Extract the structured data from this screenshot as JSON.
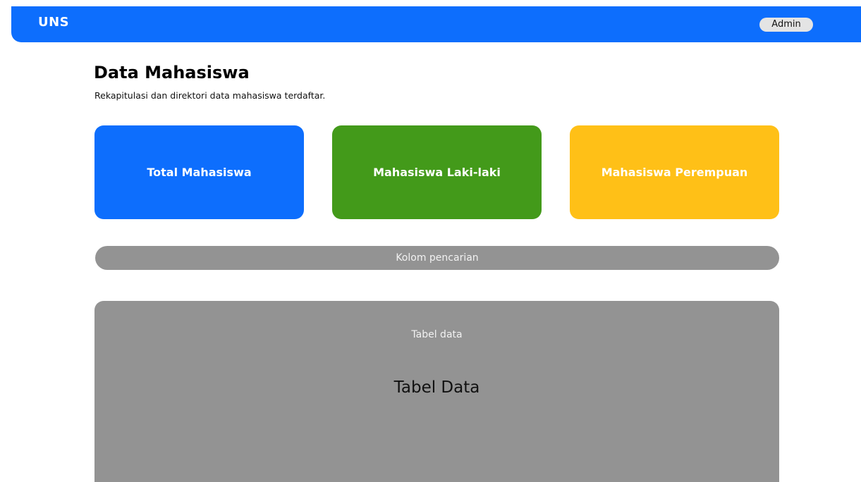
{
  "navbar": {
    "brand": "UNS",
    "user_label": "Admin",
    "color": "#0d6efd"
  },
  "header": {
    "title": "Data Mahasiswa",
    "subtitle": "Rekapitulasi dan direktori data mahasiswa terdaftar."
  },
  "cards": [
    {
      "label": "Total Mahasiswa",
      "color": "#0d6efd"
    },
    {
      "label": "Mahasiswa Laki-laki",
      "color": "#439a1a"
    },
    {
      "label": "Mahasiswa Perempuan",
      "color": "#ffc017"
    }
  ],
  "search": {
    "placeholder": "Kolom pencarian",
    "value": ""
  },
  "table": {
    "caption": "Tabel data",
    "heading": "Tabel Data"
  }
}
